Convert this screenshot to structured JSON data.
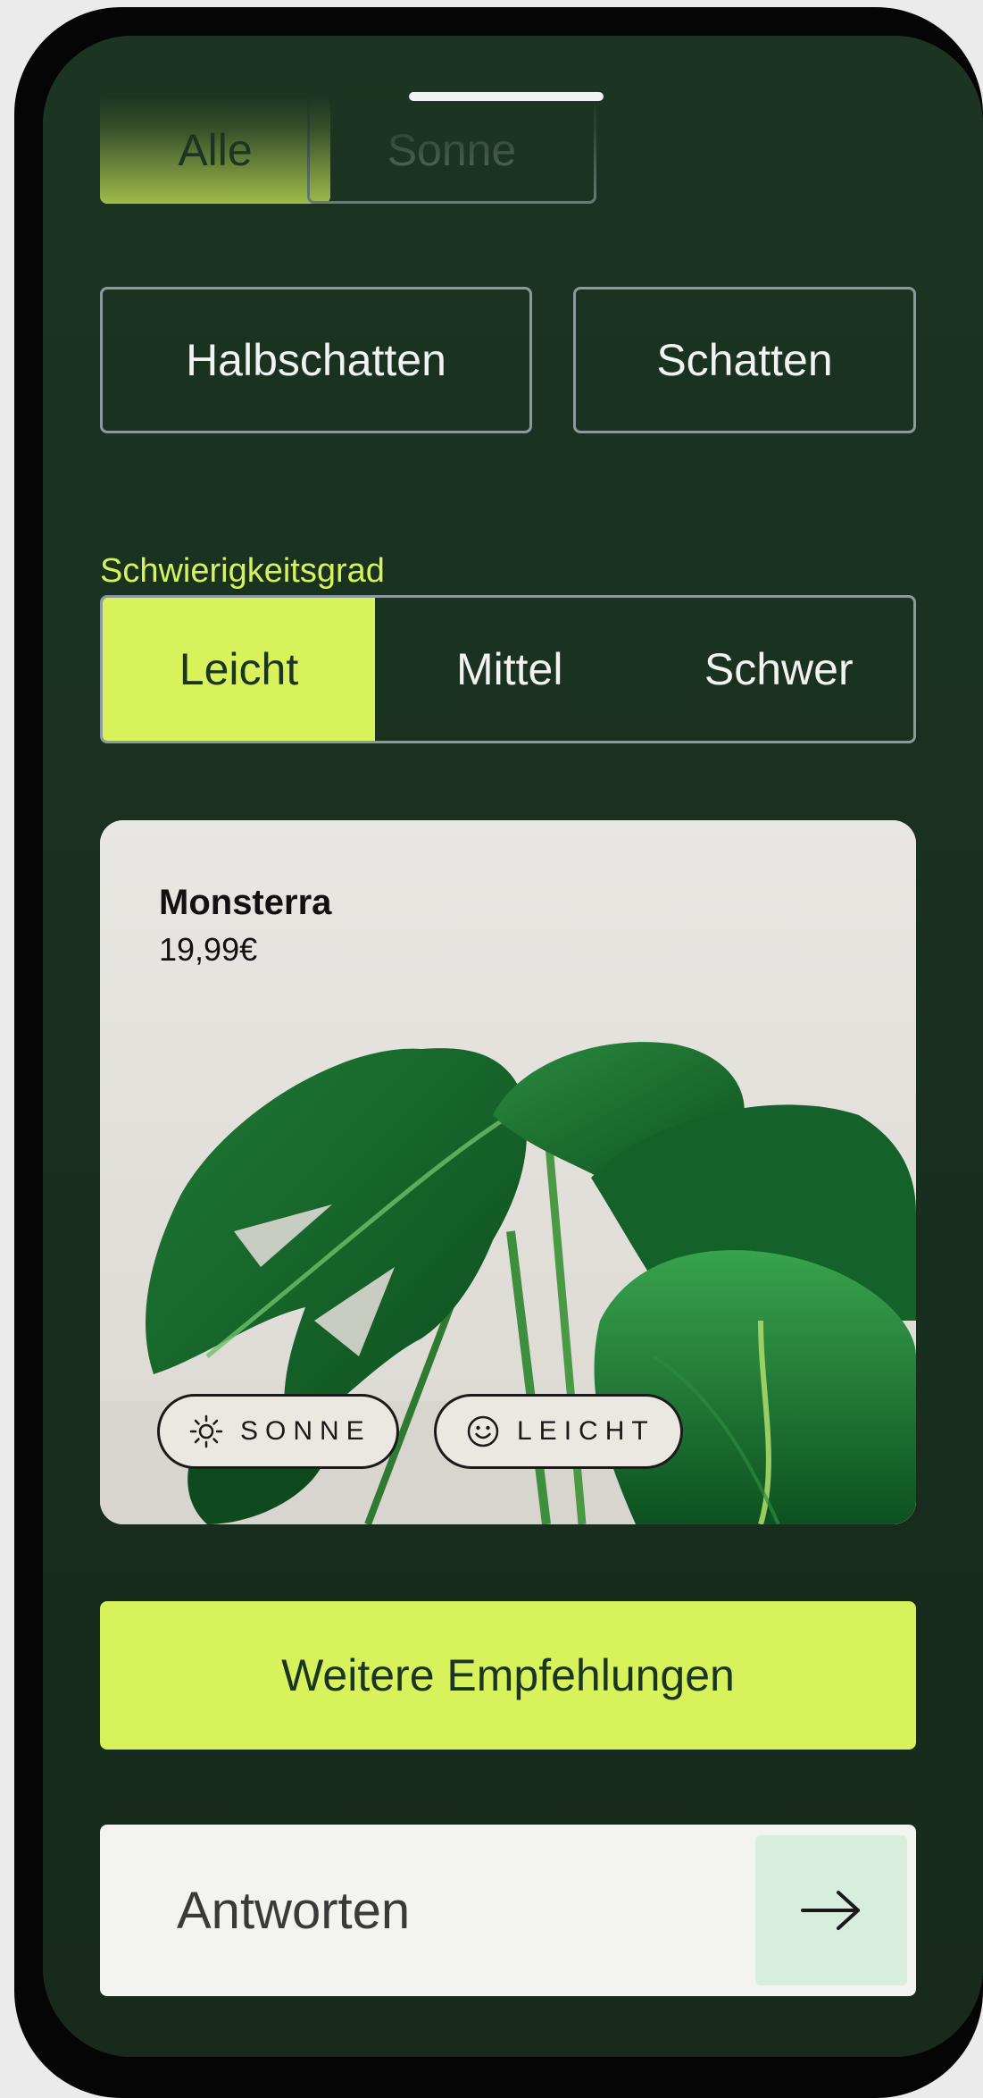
{
  "filters": {
    "light": {
      "options": [
        "Alle",
        "Sonne",
        "Halbschatten",
        "Schatten"
      ],
      "selected": "Alle"
    },
    "difficulty": {
      "label": "Schwierigkeitsgrad",
      "options": [
        "Leicht",
        "Mittel",
        "Schwer"
      ],
      "selected": "Leicht"
    }
  },
  "product_card": {
    "name": "Monsterra",
    "price": "19,99€",
    "tags": [
      {
        "icon": "sun-icon",
        "label": "SONNE"
      },
      {
        "icon": "smiley-icon",
        "label": "LEICHT"
      }
    ]
  },
  "cta": {
    "label": "Weitere Empfehlungen"
  },
  "answer": {
    "placeholder": "Antworten",
    "send_icon": "arrow-right-icon"
  },
  "colors": {
    "background": "#1b3522",
    "accent": "#d7f25a",
    "outline": "#8a9aa0",
    "send_button": "#d6eedb"
  }
}
